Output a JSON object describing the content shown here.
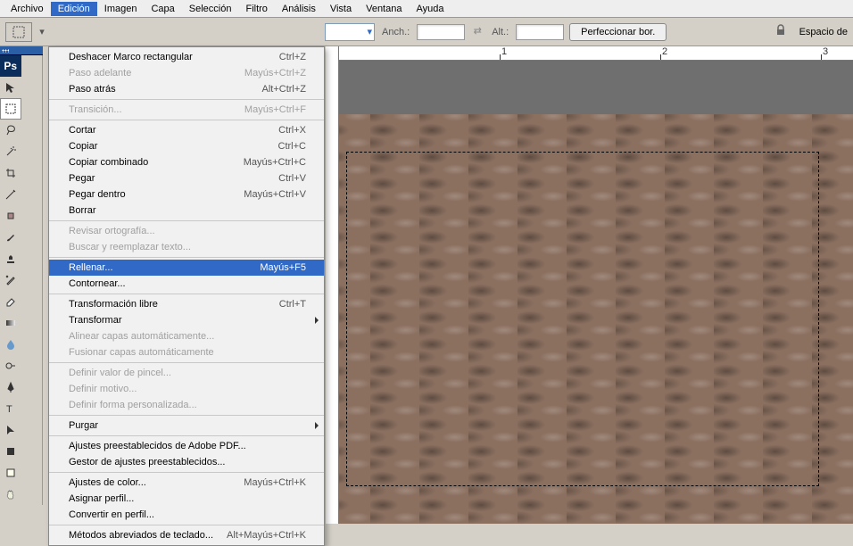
{
  "menubar": {
    "items": [
      "Archivo",
      "Edición",
      "Imagen",
      "Capa",
      "Selección",
      "Filtro",
      "Análisis",
      "Vista",
      "Ventana",
      "Ayuda"
    ],
    "active_index": 1
  },
  "options": {
    "anch_label": "Anch.:",
    "anch_value": "",
    "alt_label": "Alt.:",
    "alt_value": "",
    "refine_label": "Perfeccionar bor.",
    "workspace_label": "Espacio de"
  },
  "dropdown": {
    "groups": [
      [
        {
          "label": "Deshacer Marco rectangular",
          "shortcut": "Ctrl+Z",
          "disabled": false
        },
        {
          "label": "Paso adelante",
          "shortcut": "Mayús+Ctrl+Z",
          "disabled": true
        },
        {
          "label": "Paso atrás",
          "shortcut": "Alt+Ctrl+Z",
          "disabled": false
        }
      ],
      [
        {
          "label": "Transición...",
          "shortcut": "Mayús+Ctrl+F",
          "disabled": true
        }
      ],
      [
        {
          "label": "Cortar",
          "shortcut": "Ctrl+X",
          "disabled": false
        },
        {
          "label": "Copiar",
          "shortcut": "Ctrl+C",
          "disabled": false
        },
        {
          "label": "Copiar combinado",
          "shortcut": "Mayús+Ctrl+C",
          "disabled": false
        },
        {
          "label": "Pegar",
          "shortcut": "Ctrl+V",
          "disabled": false
        },
        {
          "label": "Pegar dentro",
          "shortcut": "Mayús+Ctrl+V",
          "disabled": false
        },
        {
          "label": "Borrar",
          "shortcut": "",
          "disabled": false
        }
      ],
      [
        {
          "label": "Revisar ortografía...",
          "shortcut": "",
          "disabled": true
        },
        {
          "label": "Buscar y reemplazar texto...",
          "shortcut": "",
          "disabled": true
        }
      ],
      [
        {
          "label": "Rellenar...",
          "shortcut": "Mayús+F5",
          "disabled": false,
          "highlight": true
        },
        {
          "label": "Contornear...",
          "shortcut": "",
          "disabled": false
        }
      ],
      [
        {
          "label": "Transformación libre",
          "shortcut": "Ctrl+T",
          "disabled": false
        },
        {
          "label": "Transformar",
          "shortcut": "",
          "disabled": false,
          "submenu": true
        },
        {
          "label": "Alinear capas automáticamente...",
          "shortcut": "",
          "disabled": true
        },
        {
          "label": "Fusionar capas automáticamente",
          "shortcut": "",
          "disabled": true
        }
      ],
      [
        {
          "label": "Definir valor de pincel...",
          "shortcut": "",
          "disabled": true
        },
        {
          "label": "Definir motivo...",
          "shortcut": "",
          "disabled": true
        },
        {
          "label": "Definir forma personalizada...",
          "shortcut": "",
          "disabled": true
        }
      ],
      [
        {
          "label": "Purgar",
          "shortcut": "",
          "disabled": false,
          "submenu": true
        }
      ],
      [
        {
          "label": "Ajustes preestablecidos de Adobe PDF...",
          "shortcut": "",
          "disabled": false
        },
        {
          "label": "Gestor de ajustes preestablecidos...",
          "shortcut": "",
          "disabled": false
        }
      ],
      [
        {
          "label": "Ajustes de color...",
          "shortcut": "Mayús+Ctrl+K",
          "disabled": false
        },
        {
          "label": "Asignar perfil...",
          "shortcut": "",
          "disabled": false
        },
        {
          "label": "Convertir en perfil...",
          "shortcut": "",
          "disabled": false
        }
      ],
      [
        {
          "label": "Métodos abreviados de teclado...",
          "shortcut": "Alt+Mayús+Ctrl+K",
          "disabled": false
        }
      ]
    ]
  },
  "ruler": {
    "marks": [
      "1",
      "2",
      "3"
    ]
  },
  "tools": {
    "ps_label": "Ps"
  }
}
